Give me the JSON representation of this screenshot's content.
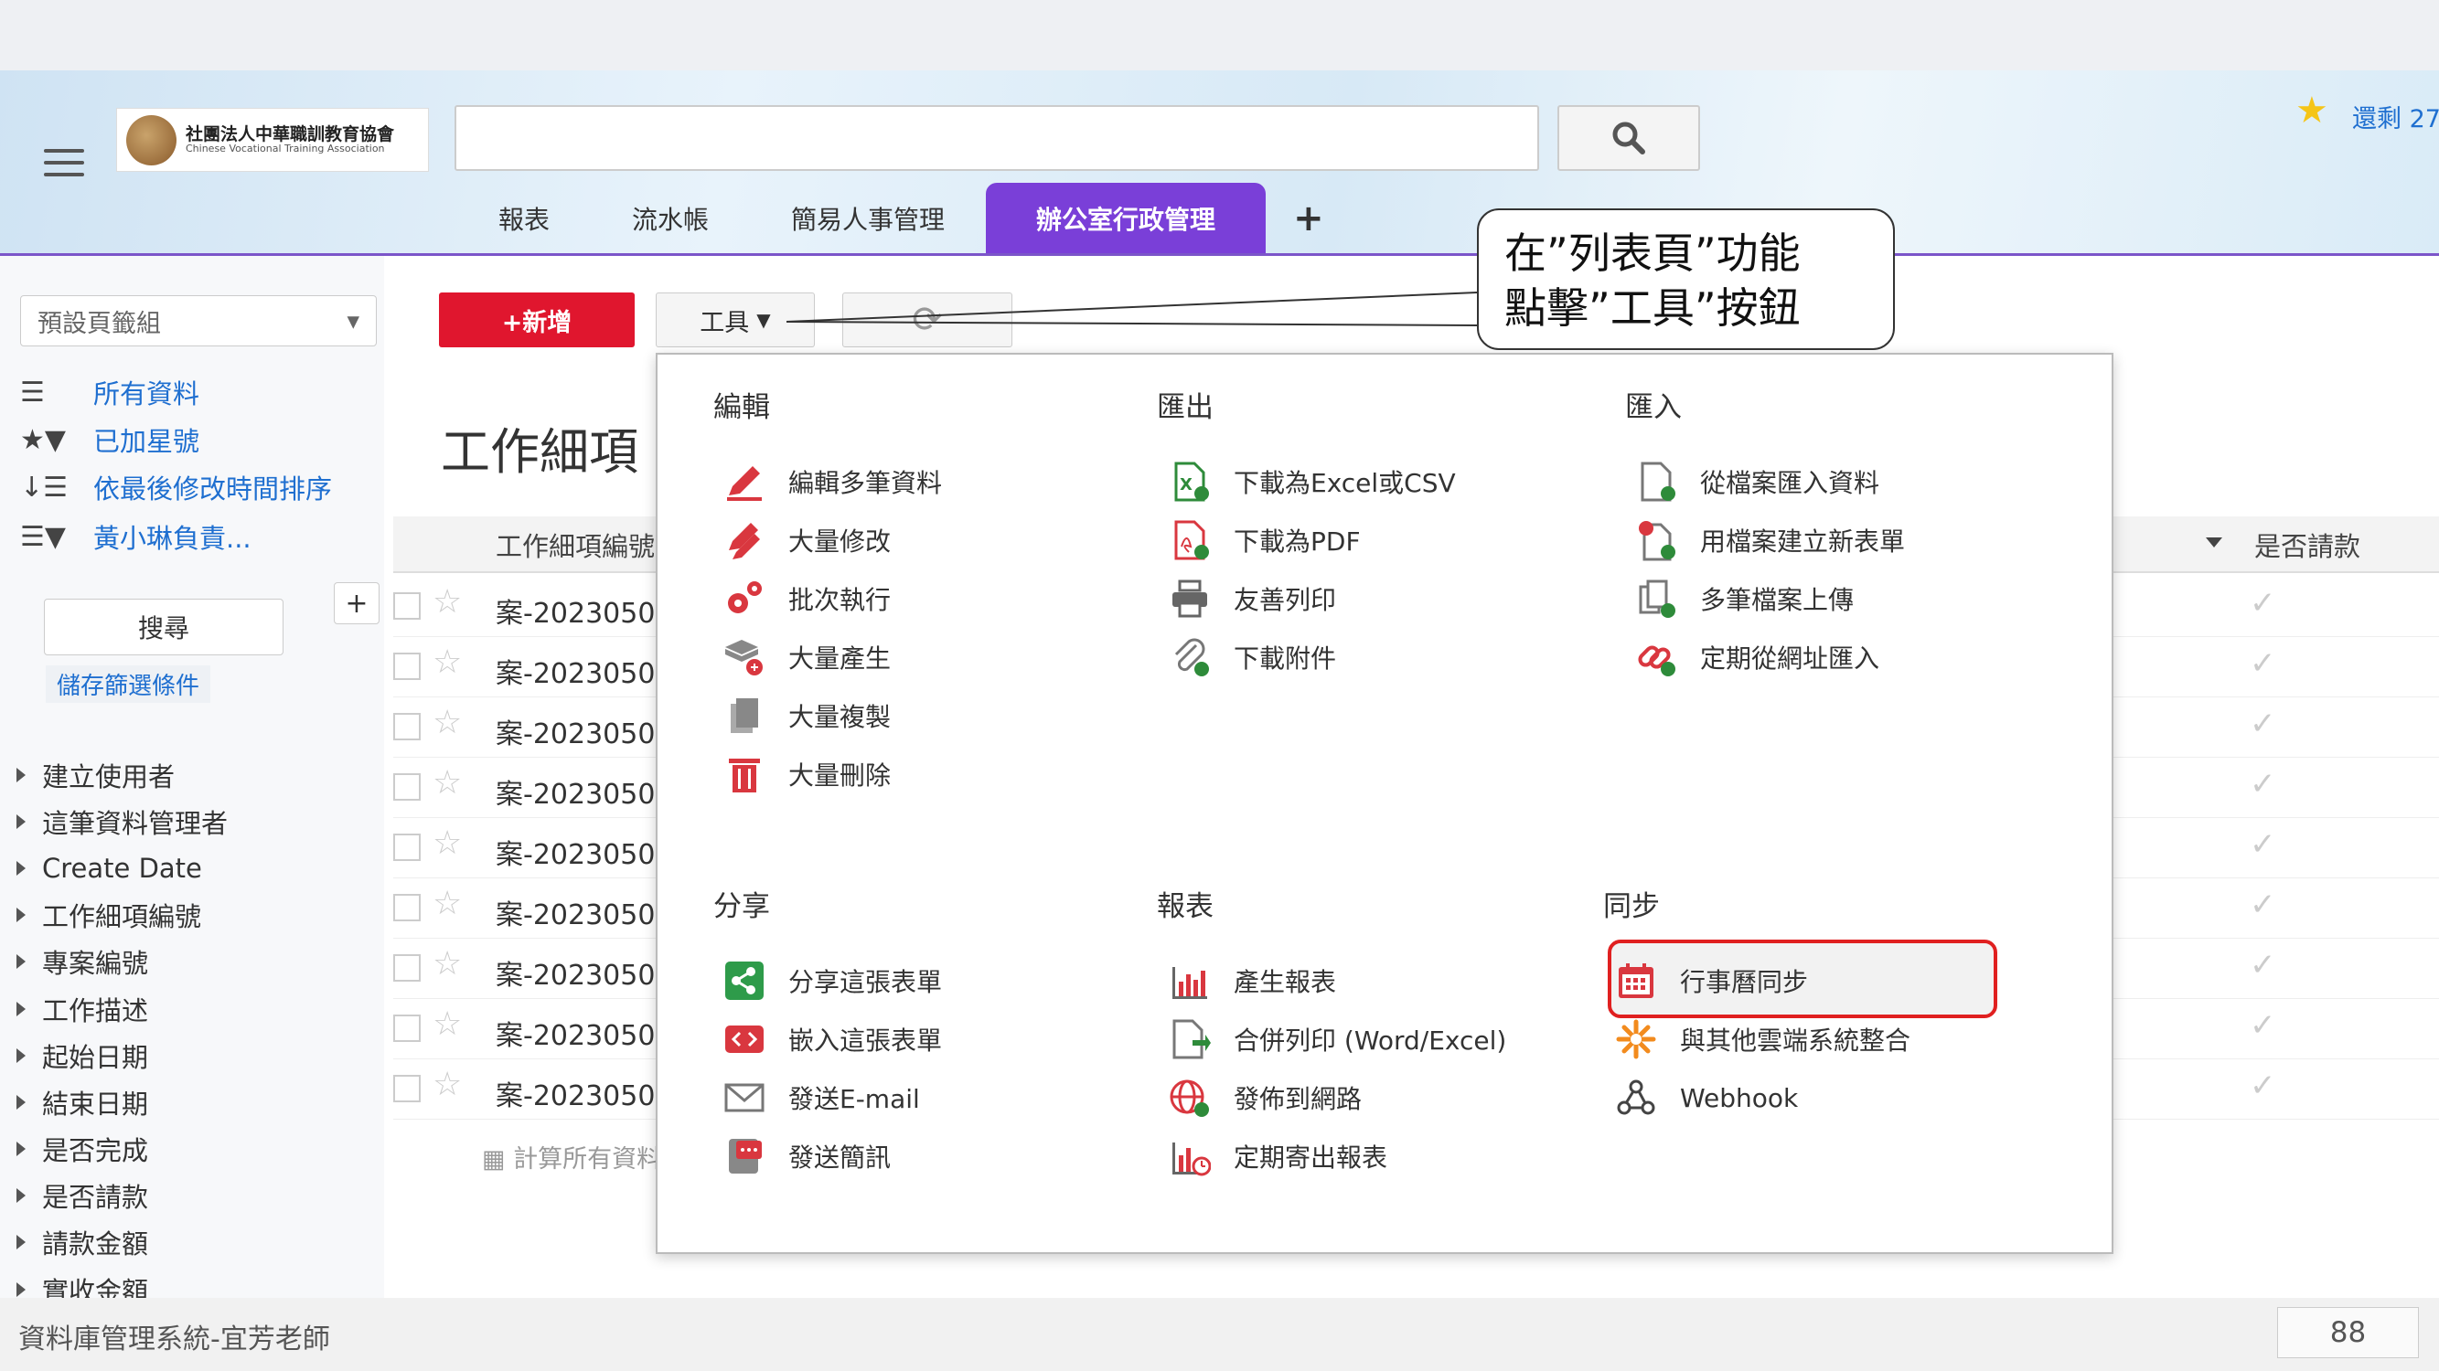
{
  "header": {
    "logo_cn": "社團法人中華職訓教育協會",
    "logo_en": "Chinese Vocational Training Association",
    "search_placeholder": "",
    "remaining_text": "還剩 27"
  },
  "tabs": [
    {
      "label": "報表"
    },
    {
      "label": "流水帳"
    },
    {
      "label": "簡易人事管理"
    },
    {
      "label": "辦公室行政管理",
      "active": true
    }
  ],
  "sidebar": {
    "view_select": "預設頁籤組",
    "filters": [
      "所有資料",
      "已加星號",
      "依最後修改時間排序",
      "黃小琳負責..."
    ],
    "search_button": "搜尋",
    "save_filter": "儲存篩選條件",
    "fields": [
      "建立使用者",
      "這筆資料管理者",
      "Create Date",
      "工作細項編號",
      "專案編號",
      "工作描述",
      "起始日期",
      "結束日期",
      "是否完成",
      "是否請款",
      "請款金額",
      "實收金額"
    ]
  },
  "toolbar": {
    "new_button": "+新增",
    "tools_button": "工具"
  },
  "main": {
    "page_title": "工作細項",
    "col_first": "工作細項編號",
    "col_last": "是否請款",
    "rows": [
      "案-20230505",
      "案-20230505",
      "案-20230505",
      "案-20230505",
      "案-20230505",
      "案-20230505",
      "案-20230505",
      "案-20230505",
      "案-20230505"
    ],
    "calc_all": "計算所有資料"
  },
  "menu": {
    "edit": {
      "title": "編輯",
      "items": [
        "編輯多筆資料",
        "大量修改",
        "批次執行",
        "大量產生",
        "大量複製",
        "大量刪除"
      ]
    },
    "export": {
      "title": "匯出",
      "items": [
        "下載為Excel或CSV",
        "下載為PDF",
        "友善列印",
        "下載附件"
      ]
    },
    "import": {
      "title": "匯入",
      "items": [
        "從檔案匯入資料",
        "用檔案建立新表單",
        "多筆檔案上傳",
        "定期從網址匯入"
      ]
    },
    "share": {
      "title": "分享",
      "items": [
        "分享這張表單",
        "嵌入這張表單",
        "發送E-mail",
        "發送簡訊"
      ]
    },
    "report": {
      "title": "報表",
      "items": [
        "產生報表",
        "合併列印 (Word/Excel)",
        "發佈到網路",
        "定期寄出報表"
      ]
    },
    "sync": {
      "title": "同步",
      "items": [
        "行事曆同步",
        "與其他雲端系統整合",
        "Webhook"
      ]
    }
  },
  "callout": {
    "line1": "在”列表頁”功能",
    "line2": "點擊”工具”按鈕"
  },
  "footer": {
    "text": "資料庫管理系統-宜芳老師",
    "page": "88"
  },
  "colors": {
    "accent_purple": "#7a3fd8",
    "new_red": "#e0162e",
    "highlight_red": "#e02020",
    "link_blue": "#1f6fd0"
  }
}
